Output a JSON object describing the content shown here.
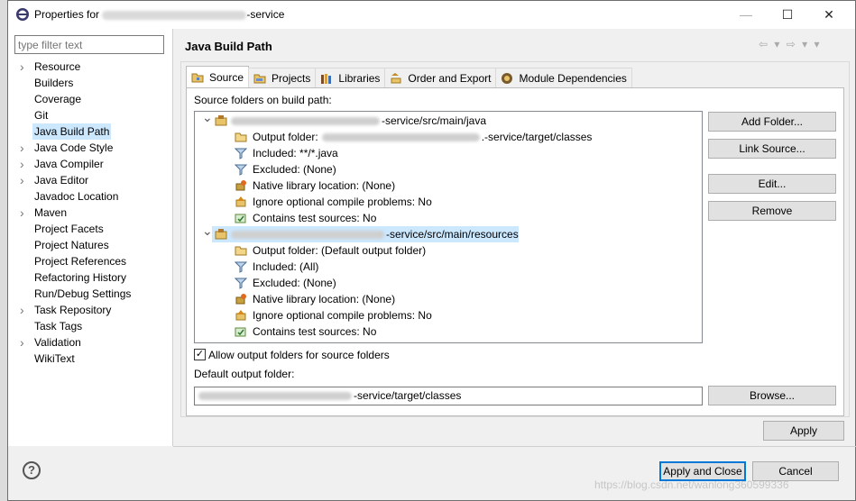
{
  "window": {
    "title_prefix": "Properties for",
    "title_suffix": "-service",
    "controls": {
      "minimize": "—",
      "maximize": "☐",
      "close": "✕"
    }
  },
  "filter": {
    "placeholder": "type filter text"
  },
  "tree": [
    {
      "label": "Resource",
      "expandable": true
    },
    {
      "label": "Builders",
      "expandable": false
    },
    {
      "label": "Coverage",
      "expandable": false
    },
    {
      "label": "Git",
      "expandable": false
    },
    {
      "label": "Java Build Path",
      "expandable": false,
      "selected": true
    },
    {
      "label": "Java Code Style",
      "expandable": true
    },
    {
      "label": "Java Compiler",
      "expandable": true
    },
    {
      "label": "Java Editor",
      "expandable": true
    },
    {
      "label": "Javadoc Location",
      "expandable": false
    },
    {
      "label": "Maven",
      "expandable": true
    },
    {
      "label": "Project Facets",
      "expandable": false
    },
    {
      "label": "Project Natures",
      "expandable": false
    },
    {
      "label": "Project References",
      "expandable": false
    },
    {
      "label": "Refactoring History",
      "expandable": false
    },
    {
      "label": "Run/Debug Settings",
      "expandable": false
    },
    {
      "label": "Task Repository",
      "expandable": true
    },
    {
      "label": "Task Tags",
      "expandable": false
    },
    {
      "label": "Validation",
      "expandable": true
    },
    {
      "label": "WikiText",
      "expandable": false
    }
  ],
  "page": {
    "title": "Java Build Path",
    "nav": "⇦ ▾ ⇨ ▾ ▾"
  },
  "tabs": [
    {
      "label": "Source",
      "icon": "source-folder-icon",
      "active": true
    },
    {
      "label": "Projects",
      "icon": "projects-icon"
    },
    {
      "label": "Libraries",
      "icon": "libraries-icon"
    },
    {
      "label": "Order and Export",
      "icon": "order-export-icon"
    },
    {
      "label": "Module Dependencies",
      "icon": "module-dependencies-icon"
    }
  ],
  "source": {
    "heading": "Source folders on build path:",
    "folders": [
      {
        "path_suffix": "-service/src/main/java",
        "children": [
          {
            "icon": "output-folder-icon",
            "text_prefix": "Output folder:",
            "text_suffix": ".-service/target/classes"
          },
          {
            "icon": "filter-icon",
            "text": "Included: **/*.java"
          },
          {
            "icon": "filter-icon",
            "text": "Excluded: (None)"
          },
          {
            "icon": "native-library-icon",
            "text": "Native library location: (None)"
          },
          {
            "icon": "warning-icon",
            "text": "Ignore optional compile problems: No"
          },
          {
            "icon": "test-source-icon",
            "text": "Contains test sources: No"
          }
        ]
      },
      {
        "path_suffix": "-service/src/main/resources",
        "children": [
          {
            "icon": "output-folder-icon",
            "text": "Output folder: (Default output folder)"
          },
          {
            "icon": "filter-icon",
            "text": "Included: (All)"
          },
          {
            "icon": "filter-icon",
            "text": "Excluded: (None)"
          },
          {
            "icon": "native-library-icon",
            "text": "Native library location: (None)"
          },
          {
            "icon": "warning-icon",
            "text": "Ignore optional compile problems: No"
          },
          {
            "icon": "test-source-icon",
            "text": "Contains test sources: No"
          }
        ]
      }
    ],
    "buttons": {
      "add_folder": "Add Folder...",
      "link_source": "Link Source...",
      "edit": "Edit...",
      "remove": "Remove"
    },
    "allow_output_label": "Allow output folders for source folders",
    "allow_output_checked": true,
    "default_output_label": "Default output folder:",
    "default_output_suffix": "-service/target/classes",
    "browse": "Browse..."
  },
  "footer": {
    "apply": "Apply",
    "apply_and_close": "Apply and Close",
    "cancel": "Cancel",
    "help": "?",
    "watermark": "https://blog.csdn.net/wanlong360599336"
  },
  "colors": {
    "selection": "#cce8ff",
    "default_button_border": "#0078d7"
  }
}
